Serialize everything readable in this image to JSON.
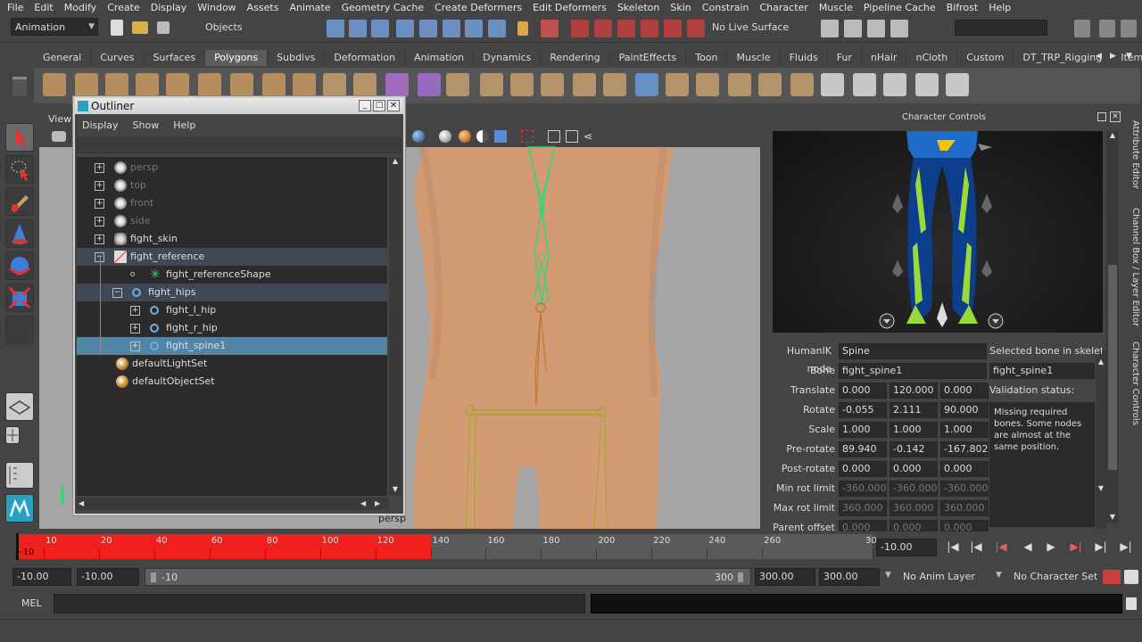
{
  "menubar": [
    "File",
    "Edit",
    "Modify",
    "Create",
    "Display",
    "Window",
    "Assets",
    "Animate",
    "Geometry Cache",
    "Create Deformers",
    "Edit Deformers",
    "Skeleton",
    "Skin",
    "Constrain",
    "Character",
    "Muscle",
    "Pipeline Cache",
    "Bifrost",
    "Help"
  ],
  "statusline": {
    "menuset": "Animation",
    "selection_mode": "Objects",
    "live_surface": "No Live Surface"
  },
  "shelf_tabs": [
    "General",
    "Curves",
    "Surfaces",
    "Polygons",
    "Subdivs",
    "Deformation",
    "Animation",
    "Dynamics",
    "Rendering",
    "PaintEffects",
    "Toon",
    "Muscle",
    "Fluids",
    "Fur",
    "nHair",
    "nCloth",
    "Custom",
    "DT_TRP_Rigging",
    "Item"
  ],
  "shelf_active": "Polygons",
  "viewport": {
    "menu_label": "View",
    "camera_label": "persp"
  },
  "outliner": {
    "title": "Outliner",
    "menu": [
      "Display",
      "Show",
      "Help"
    ],
    "rows": [
      {
        "label": "persp",
        "dim": true
      },
      {
        "label": "top",
        "dim": true
      },
      {
        "label": "front",
        "dim": true
      },
      {
        "label": "side",
        "dim": true
      },
      {
        "label": "fight_skin",
        "dim": false
      },
      {
        "label": "fight_reference",
        "dim": false
      },
      {
        "label": "fight_referenceShape",
        "dim": false
      },
      {
        "label": "fight_hips",
        "dim": false
      },
      {
        "label": "fight_l_hip",
        "dim": false
      },
      {
        "label": "fight_r_hip",
        "dim": false
      },
      {
        "label": "fight_spine1",
        "dim": false
      },
      {
        "label": "defaultLightSet",
        "dim": false
      },
      {
        "label": "defaultObjectSet",
        "dim": false
      }
    ]
  },
  "character_controls": {
    "title": "Character Controls",
    "humanik_node_label": "HumanIK node",
    "humanik_node": "Spine",
    "selected_bone_label": "Selected bone in skeleton:",
    "bone_label": "Bone",
    "bone": "fight_spine1",
    "selected_bone": "fight_spine1",
    "validation_label": "Validation status:",
    "validation_msg": "Missing required bones. Some nodes are almost at the same position.",
    "rows": [
      {
        "label": "Translate",
        "values": [
          "0.000",
          "120.000",
          "0.000"
        ],
        "disabled": false
      },
      {
        "label": "Rotate",
        "values": [
          "-0.055",
          "2.111",
          "90.000"
        ],
        "disabled": false
      },
      {
        "label": "Scale",
        "values": [
          "1.000",
          "1.000",
          "1.000"
        ],
        "disabled": false
      },
      {
        "label": "Pre-rotate",
        "values": [
          "89.940",
          "-0.142",
          "-167.802"
        ],
        "disabled": false
      },
      {
        "label": "Post-rotate",
        "values": [
          "0.000",
          "0.000",
          "0.000"
        ],
        "disabled": false
      },
      {
        "label": "Min rot limit",
        "values": [
          "-360.000",
          "-360.000",
          "-360.000"
        ],
        "disabled": true
      },
      {
        "label": "Max rot limit",
        "values": [
          "360.000",
          "360.000",
          "360.000"
        ],
        "disabled": true
      },
      {
        "label": "Parent offset P",
        "values": [
          "0.000",
          "0.000",
          "0.000"
        ],
        "disabled": true
      }
    ]
  },
  "right_tabs": [
    "Attribute Editor",
    "Channel Box / Layer Editor",
    "Character Controls"
  ],
  "timeline": {
    "ticks": [
      "10",
      "20",
      "40",
      "60",
      "80",
      "100",
      "120",
      "140",
      "160",
      "180",
      "200",
      "220",
      "240",
      "260",
      "30"
    ],
    "current_frame_label": "-10",
    "current_time": "-10.00",
    "played_to": 140,
    "range_start": -10,
    "range_end": 300
  },
  "range": {
    "anim_start": "-10.00",
    "playback_start": "-10.00",
    "slider_start": "-10",
    "slider_end": "300",
    "playback_end": "300.00",
    "anim_end": "300.00",
    "anim_layer": "No Anim Layer",
    "character_set": "No Character Set"
  },
  "cmdline": {
    "label": "MEL"
  }
}
